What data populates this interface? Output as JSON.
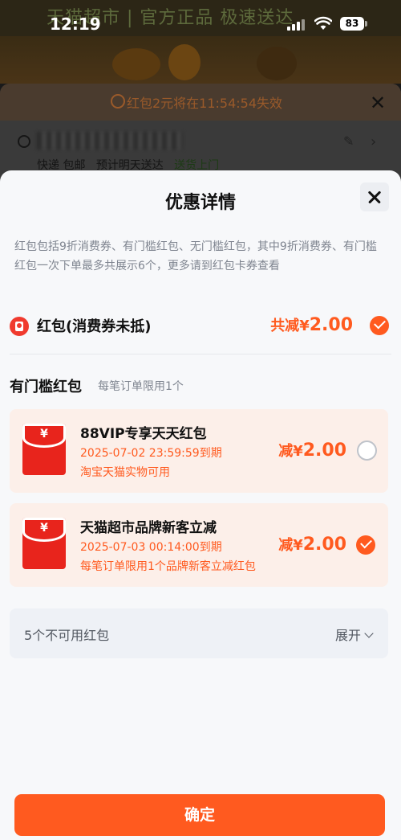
{
  "status_bar": {
    "time": "12:19",
    "battery": "83"
  },
  "background": {
    "banner": "天猫超市 | 官方正品 极速送达",
    "expire_notice": "红包2元将在11:54:54失效",
    "shipping": {
      "express": "快递 包邮",
      "eta": "预计明天送达",
      "door": "送货上门"
    }
  },
  "sheet": {
    "title": "优惠详情",
    "description": "红包包括9折消费券、有门槛红包、无门槛红包，其中9折消费券、有门槛红包一次下单最多共展示6个，更多请到红包卡券查看",
    "summary": {
      "label": "红包(消费券未抵)",
      "prefix": "共减",
      "currency": "¥",
      "amount": "2.00",
      "checked": true
    },
    "threshold_section": {
      "title": "有门槛红包",
      "note": "每笔订单限用1个"
    },
    "coupons": [
      {
        "title": "88VIP专享天天红包",
        "expiry": "2025-07-02 23:59:59到期",
        "scope": "淘宝天猫实物可用",
        "prefix": "减",
        "currency": "¥",
        "amount": "2.00",
        "selected": false
      },
      {
        "title": "天猫超市品牌新客立减",
        "expiry": "2025-07-03 00:14:00到期",
        "scope": "每笔订单限用1个品牌新客立减红包",
        "prefix": "减",
        "currency": "¥",
        "amount": "2.00",
        "selected": true
      }
    ],
    "unavailable": {
      "label": "5个不可用红包",
      "expand": "展开"
    },
    "confirm": "确定"
  },
  "icons": {
    "yen": "¥",
    "close": "close-icon",
    "check": "check-circle-icon",
    "packet": "red-packet-icon"
  },
  "colors": {
    "accent": "#ff5a1f",
    "card_bg": "#fcefe9",
    "envelope": "#e8241c"
  }
}
